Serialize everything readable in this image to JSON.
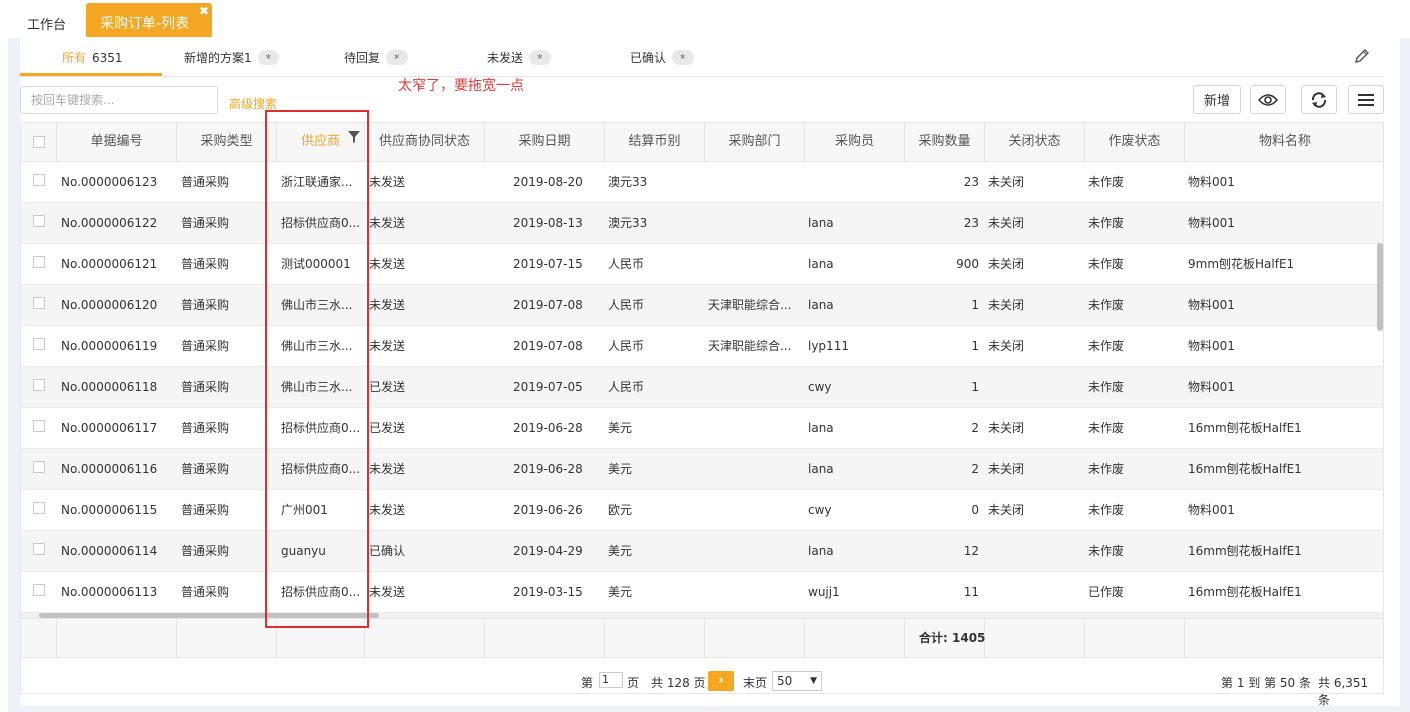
{
  "tabs": {
    "home": "工作台",
    "active": "采购订单-列表",
    "close": "✖"
  },
  "filter_tabs": [
    {
      "label": "所有",
      "count": "6351"
    },
    {
      "label": "新增的方案1",
      "badge": "*"
    },
    {
      "label": "待回复",
      "badge": "*"
    },
    {
      "label": "未发送",
      "badge": "*"
    },
    {
      "label": "已确认",
      "badge": "*"
    }
  ],
  "annotation": "太窄了，要拖宽一点",
  "search": {
    "placeholder": "按回车键搜索...",
    "advanced": "高级搜索"
  },
  "toolbar": {
    "add_label": "新增",
    "icons": [
      "eye-icon",
      "refresh-icon",
      "menu-icon"
    ]
  },
  "columns": [
    "单据编号",
    "采购类型",
    "供应商",
    "供应商协同状态",
    "采购日期",
    "结算币别",
    "采购部门",
    "采购员",
    "采购数量",
    "关闭状态",
    "作废状态",
    "物料名称"
  ],
  "rows": [
    [
      "No.0000006123",
      "普通采购",
      "浙江联通家...",
      "未发送",
      "2019-08-20",
      "澳元33",
      "",
      "",
      "23",
      "未关闭",
      "未作废",
      "物料001"
    ],
    [
      "No.0000006122",
      "普通采购",
      "招标供应商0...",
      "未发送",
      "2019-08-13",
      "澳元33",
      "",
      "lana",
      "23",
      "未关闭",
      "未作废",
      "物料001"
    ],
    [
      "No.0000006121",
      "普通采购",
      "测试000001",
      "未发送",
      "2019-07-15",
      "人民币",
      "",
      "lana",
      "900",
      "未关闭",
      "未作废",
      "9mm刨花板HalfE1"
    ],
    [
      "No.0000006120",
      "普通采购",
      "佛山市三水...",
      "未发送",
      "2019-07-08",
      "人民币",
      "天津职能综合...",
      "lana",
      "1",
      "未关闭",
      "未作废",
      "物料001"
    ],
    [
      "No.0000006119",
      "普通采购",
      "佛山市三水...",
      "未发送",
      "2019-07-08",
      "人民币",
      "天津职能综合...",
      "lyp111",
      "1",
      "未关闭",
      "未作废",
      "物料001"
    ],
    [
      "No.0000006118",
      "普通采购",
      "佛山市三水...",
      "已发送",
      "2019-07-05",
      "人民币",
      "",
      "cwy",
      "1",
      "",
      "未作废",
      "物料001"
    ],
    [
      "No.0000006117",
      "普通采购",
      "招标供应商0...",
      "已发送",
      "2019-06-28",
      "美元",
      "",
      "lana",
      "2",
      "未关闭",
      "未作废",
      "16mm刨花板HalfE1"
    ],
    [
      "No.0000006116",
      "普通采购",
      "招标供应商0...",
      "未发送",
      "2019-06-28",
      "美元",
      "",
      "lana",
      "2",
      "未关闭",
      "未作废",
      "16mm刨花板HalfE1"
    ],
    [
      "No.0000006115",
      "普通采购",
      "广州001",
      "未发送",
      "2019-06-26",
      "欧元",
      "",
      "cwy",
      "0",
      "未关闭",
      "未作废",
      "物料001"
    ],
    [
      "No.0000006114",
      "普通采购",
      "guanyu",
      "已确认",
      "2019-04-29",
      "美元",
      "",
      "lana",
      "12",
      "",
      "未作废",
      "16mm刨花板HalfE1"
    ],
    [
      "No.0000006113",
      "普通采购",
      "招标供应商0...",
      "未发送",
      "2019-03-15",
      "美元",
      "",
      "wujj1",
      "11",
      "",
      "已作废",
      "16mm刨花板HalfE1"
    ]
  ],
  "summary": {
    "total_label": "合计:",
    "total_value": "1405"
  },
  "pager": {
    "prefix": "第",
    "current_page": "1",
    "page_suffix": "页",
    "total_pages": "共 128 页",
    "next": "›",
    "last": "末页",
    "page_size": "50",
    "range": "第 1 到 第 50 条",
    "total_records": "共 6,351 条"
  }
}
